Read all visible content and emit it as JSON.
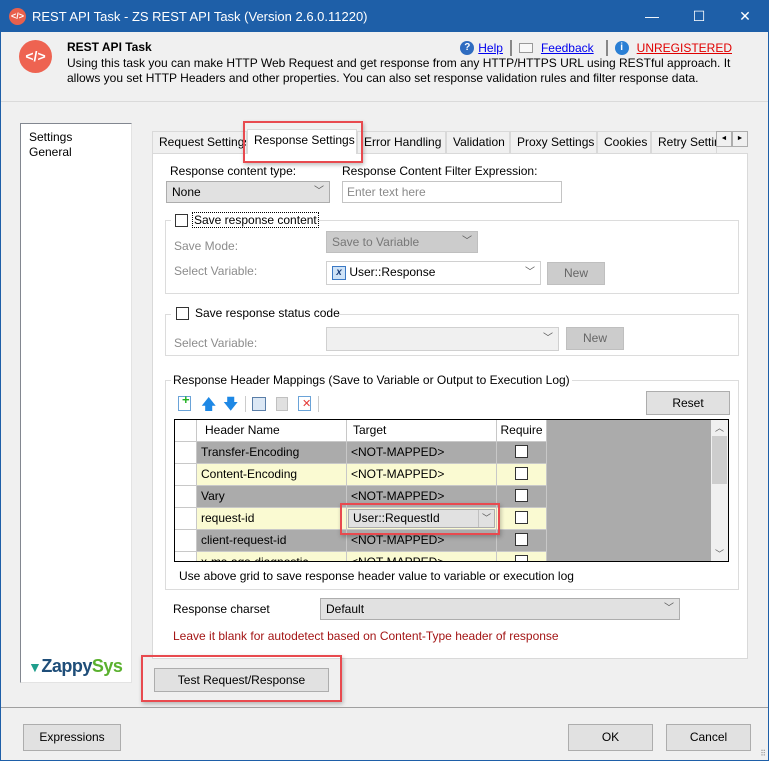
{
  "window": {
    "title": "REST API Task - ZS REST API Task (Version 2.6.0.11220)",
    "controls": {
      "minimize": "—",
      "maximize": "☐",
      "close": "✕"
    }
  },
  "header": {
    "logo_glyph": "</>",
    "title": "REST API Task",
    "description": "Using this task you can make HTTP Web Request and get response from any HTTP/HTTPS URL using RESTful approach. It allows you set HTTP Headers and other properties. You can also set response validation rules and filter response data.",
    "help_label": "Help",
    "feedback_label": "Feedback",
    "unregistered_label": "UNREGISTERED",
    "help_glyph": "?",
    "info_glyph": "i",
    "colors": {
      "link": "#0000ee",
      "unregistered": "#e00000",
      "brand": "#ee6351"
    }
  },
  "sidebar": {
    "items": [
      {
        "label": "Settings"
      },
      {
        "label": "General"
      }
    ],
    "brand_part1": "Zappy",
    "brand_part2": "Sys",
    "brand_glyph": "▼"
  },
  "tabs": {
    "items": [
      {
        "label": "Request Settings"
      },
      {
        "label": "Response Settings",
        "active": true
      },
      {
        "label": "Error Handling"
      },
      {
        "label": "Validation"
      },
      {
        "label": "Proxy Settings"
      },
      {
        "label": "Cookies"
      },
      {
        "label": "Retry Settings"
      }
    ],
    "scroll_left": "◄",
    "scroll_right": "►"
  },
  "response": {
    "content_type_label": "Response content type:",
    "content_type_value": "None",
    "filter_label": "Response Content Filter Expression:",
    "filter_placeholder": "Enter text here",
    "save_content": {
      "label": "Save response content",
      "checked": false,
      "save_mode_label": "Save Mode:",
      "save_mode_value": "Save to Variable",
      "select_variable_label": "Select Variable:",
      "variable_value": "User::Response",
      "variable_icon": "x",
      "new_label": "New"
    },
    "save_status": {
      "label": "Save response status code",
      "checked": false,
      "select_variable_label": "Select Variable:",
      "variable_value": "",
      "new_label": "New"
    },
    "header_mappings": {
      "title": "Response Header Mappings (Save to Variable or Output to Execution Log)",
      "toolbar": [
        "add-row",
        "move-up",
        "move-down",
        "copy",
        "paste",
        "delete"
      ],
      "reset_label": "Reset",
      "columns": [
        "Header Name",
        "Target",
        "Require"
      ],
      "rows": [
        {
          "header": "Transfer-Encoding",
          "target": "<NOT-MAPPED>",
          "required": false
        },
        {
          "header": "Content-Encoding",
          "target": "<NOT-MAPPED>",
          "required": false
        },
        {
          "header": "Vary",
          "target": "<NOT-MAPPED>",
          "required": false
        },
        {
          "header": "request-id",
          "target": "User::RequestId",
          "required": false,
          "editing": true
        },
        {
          "header": "client-request-id",
          "target": "<NOT-MAPPED>",
          "required": false
        },
        {
          "header": "x-ms-ags-diagnostic",
          "target": "<NOT-MAPPED>",
          "required": false
        }
      ],
      "hint": "Use above grid to save response header value to variable or execution log"
    },
    "charset_label": "Response charset",
    "charset_value": "Default",
    "charset_hint": "Leave it blank for autodetect based on Content-Type header of response",
    "charset_hint_color": "#a31515"
  },
  "footer": {
    "test_button": "Test Request/Response",
    "expressions_button": "Expressions",
    "ok_button": "OK",
    "cancel_button": "Cancel"
  }
}
